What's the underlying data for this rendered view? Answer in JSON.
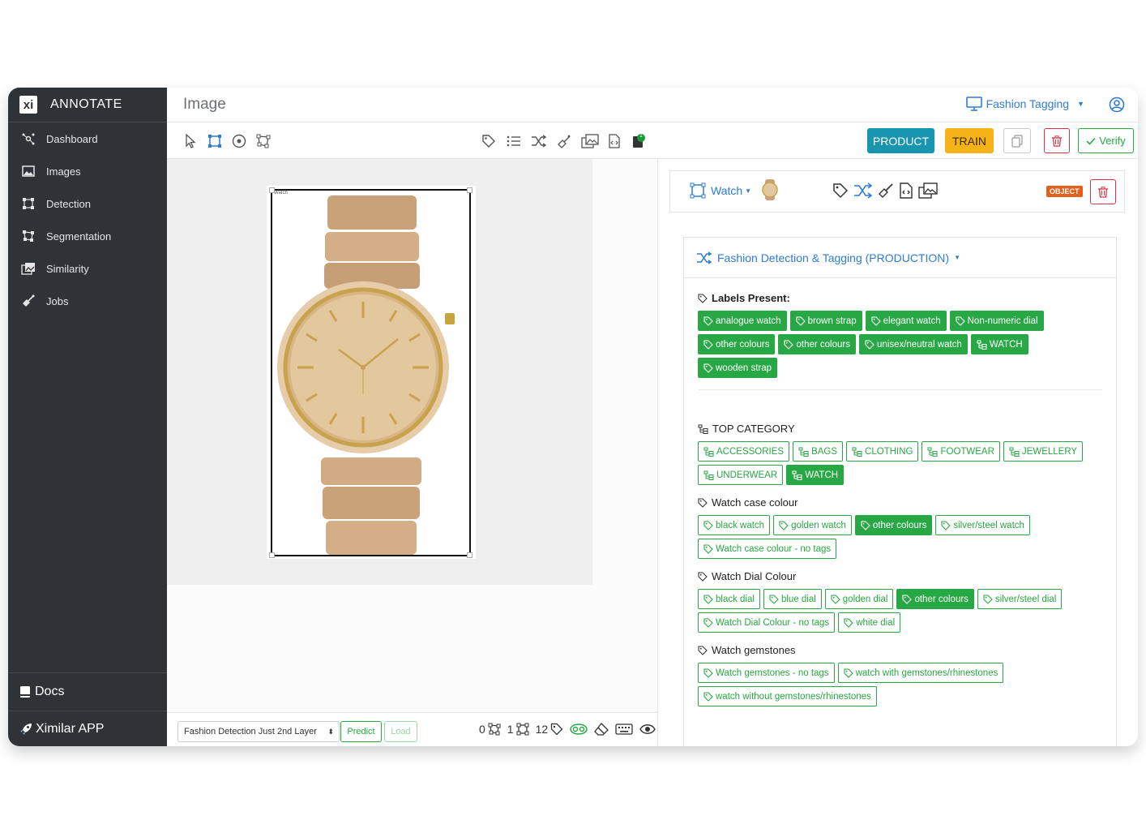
{
  "brand": {
    "logo": "xi",
    "name": "ANNOTATE"
  },
  "sidebar": {
    "items": [
      {
        "label": "Dashboard",
        "icon": "dashboard-icon"
      },
      {
        "label": "Images",
        "icon": "image-icon"
      },
      {
        "label": "Detection",
        "icon": "detection-icon"
      },
      {
        "label": "Segmentation",
        "icon": "segmentation-icon"
      },
      {
        "label": "Similarity",
        "icon": "similarity-icon"
      },
      {
        "label": "Jobs",
        "icon": "jobs-icon"
      }
    ],
    "docs": "Docs",
    "app": "Ximilar APP"
  },
  "header": {
    "title": "Image",
    "project": "Fashion Tagging"
  },
  "toolbar": {
    "product": "PRODUCT",
    "train": "TRAIN",
    "verify": "Verify",
    "badge_count": "1"
  },
  "bottom": {
    "model": "Fashion Detection Just 2nd Layer",
    "predict": "Predict",
    "load": "Load",
    "count_a": "0",
    "count_b": "1",
    "count_c": "12"
  },
  "object": {
    "name": "Watch",
    "badge": "OBJECT",
    "bbox_label": "Watch"
  },
  "task": {
    "title": "Fashion Detection & Tagging (PRODUCTION)"
  },
  "sections": {
    "labels_present": {
      "title": "Labels Present:",
      "tags": [
        {
          "label": "analogue watch",
          "on": true,
          "icon": "tag"
        },
        {
          "label": "brown strap",
          "on": true,
          "icon": "tag"
        },
        {
          "label": "elegant watch",
          "on": true,
          "icon": "tag"
        },
        {
          "label": "Non-numeric dial",
          "on": true,
          "icon": "tag"
        },
        {
          "label": "other colours",
          "on": true,
          "icon": "tag"
        },
        {
          "label": "other colours",
          "on": true,
          "icon": "tag"
        },
        {
          "label": "unisex/neutral watch",
          "on": true,
          "icon": "tag"
        },
        {
          "label": "WATCH",
          "on": true,
          "icon": "tree"
        },
        {
          "label": "wooden strap",
          "on": true,
          "icon": "tag"
        }
      ]
    },
    "top_category": {
      "title": "TOP CATEGORY",
      "tags": [
        {
          "label": "ACCESSORIES",
          "on": false,
          "icon": "tree"
        },
        {
          "label": "BAGS",
          "on": false,
          "icon": "tree"
        },
        {
          "label": "CLOTHING",
          "on": false,
          "icon": "tree"
        },
        {
          "label": "FOOTWEAR",
          "on": false,
          "icon": "tree"
        },
        {
          "label": "JEWELLERY",
          "on": false,
          "icon": "tree"
        },
        {
          "label": "UNDERWEAR",
          "on": false,
          "icon": "tree"
        },
        {
          "label": "WATCH",
          "on": true,
          "icon": "tree"
        }
      ]
    },
    "case_colour": {
      "title": "Watch case colour",
      "tags": [
        {
          "label": "black watch",
          "on": false,
          "icon": "tag"
        },
        {
          "label": "golden watch",
          "on": false,
          "icon": "tag"
        },
        {
          "label": "other colours",
          "on": true,
          "icon": "tag"
        },
        {
          "label": "silver/steel watch",
          "on": false,
          "icon": "tag"
        },
        {
          "label": "Watch case colour - no tags",
          "on": false,
          "icon": "tag"
        }
      ]
    },
    "dial_colour": {
      "title": "Watch Dial Colour",
      "tags": [
        {
          "label": "black dial",
          "on": false,
          "icon": "tag"
        },
        {
          "label": "blue dial",
          "on": false,
          "icon": "tag"
        },
        {
          "label": "golden dial",
          "on": false,
          "icon": "tag"
        },
        {
          "label": "other colours",
          "on": true,
          "icon": "tag"
        },
        {
          "label": "silver/steel dial",
          "on": false,
          "icon": "tag"
        },
        {
          "label": "Watch Dial Colour - no tags",
          "on": false,
          "icon": "tag"
        },
        {
          "label": "white dial",
          "on": false,
          "icon": "tag"
        }
      ]
    },
    "gemstones": {
      "title": "Watch gemstones",
      "tags": [
        {
          "label": "Watch gemstones - no tags",
          "on": false,
          "icon": "tag"
        },
        {
          "label": "watch with gemstones/rhinestones",
          "on": false,
          "icon": "tag"
        },
        {
          "label": "watch without gemstones/rhinestones",
          "on": false,
          "icon": "tag"
        }
      ]
    }
  },
  "colors": {
    "sidebar": "#2f3337",
    "primary": "#2f7cd3",
    "success": "#28a745",
    "product": "#1896b0",
    "train": "#f6b319",
    "danger": "#dc3545",
    "object_badge": "#e45f1b"
  }
}
